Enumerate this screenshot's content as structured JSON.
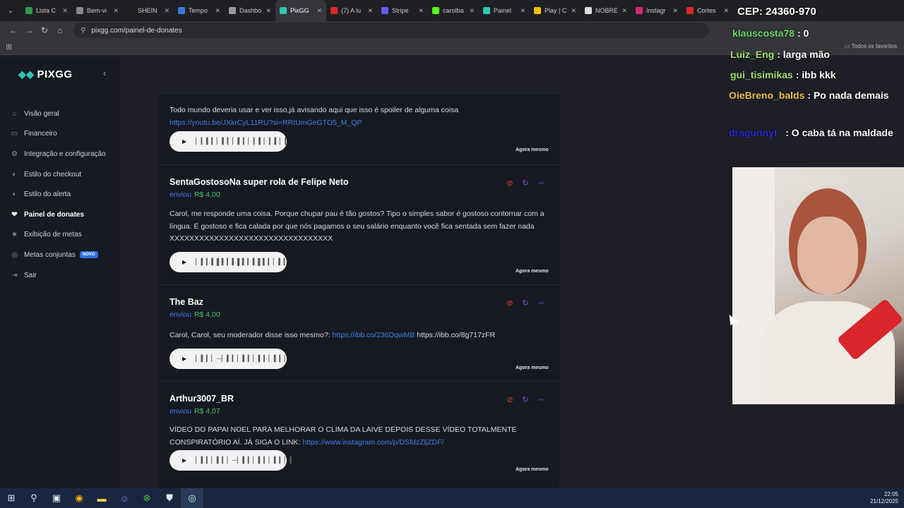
{
  "browser": {
    "tabs": [
      {
        "label": "Lista C",
        "color": "#2e9d4a"
      },
      {
        "label": "Bem-vi",
        "color": "#888888"
      },
      {
        "label": "SHEIN",
        "color": "#222222"
      },
      {
        "label": "Tempo",
        "color": "#3b7be0"
      },
      {
        "label": "Dashbo",
        "color": "#999999"
      },
      {
        "label": "PixGG",
        "color": "#2ec6b4"
      },
      {
        "label": "(7) A lu",
        "color": "#e02828"
      },
      {
        "label": "Stripe",
        "color": "#635bff"
      },
      {
        "label": "carolba",
        "color": "#53fc18"
      },
      {
        "label": "Painel",
        "color": "#2ec6b4"
      },
      {
        "label": "Play | C",
        "color": "#f2c200"
      },
      {
        "label": "NOBRE",
        "color": "#dddddd"
      },
      {
        "label": "Instagr",
        "color": "#d62976"
      },
      {
        "label": "Cortes",
        "color": "#e02828"
      }
    ],
    "active_tab": 5,
    "url": "pixgg.com/painel-de-donates",
    "bookmarks_label": "Todos os favoritos"
  },
  "sidebar": {
    "brand": "PIXGG",
    "items": [
      {
        "label": "Visão geral",
        "icon": "home-icon",
        "glyph": "⌂"
      },
      {
        "label": "Financeiro",
        "icon": "wallet-icon",
        "glyph": "▭"
      },
      {
        "label": "Integração e configuração",
        "icon": "settings-icon",
        "glyph": "⚙"
      },
      {
        "label": "Estilo do checkout",
        "icon": "palette-icon",
        "glyph": "◐"
      },
      {
        "label": "Estilo do alerta",
        "icon": "palette-icon",
        "glyph": "◐"
      },
      {
        "label": "Painel de donates",
        "icon": "donate-icon",
        "glyph": "❤"
      },
      {
        "label": "Exibição de metas",
        "icon": "star-icon",
        "glyph": "★"
      },
      {
        "label": "Metas conjuntas",
        "icon": "target-icon",
        "glyph": "◎",
        "badge": "NOVO"
      },
      {
        "label": "Sair",
        "icon": "logout-icon",
        "glyph": "⇥"
      }
    ],
    "active_index": 5
  },
  "donates": [
    {
      "name": "",
      "sent_label": "",
      "amount": "",
      "message": "Todo mundo deveria usar e ver isso,já avisando aqui que isso é spoiler de alguma coisa",
      "link": "https://youtu.be/JXkrCyL11RU?si=RRtUmGeGTO5_M_QP",
      "link_after": "",
      "waveform": "▏▎▍▎▏▍▎▏▍▎▏▎▍▏▎▍▏▎",
      "time": "Agora mesmo"
    },
    {
      "name": "SentaGostosoNa super rola de Felipe Neto",
      "sent_label": "enviou",
      "amount": "R$ 4,00",
      "message": "Carol, me responde uma coisa. Porque chupar pau é tão gostos? Tipo o simples sabor é gostoso contornar com a língua. É gostoso e fica calada por que nós pagamos o seu salário enquanto você fica sentada sem fazer nada XXXXXXXXXXXXXXXXXXXXXXXXXXXXXXXXX",
      "link": "",
      "link_after": "",
      "waveform": "▏▍▎▍▌▍▎▍▌▍▎▍▌▍▎▏▍▎",
      "time": "Agora mesmo"
    },
    {
      "name": "The Baz",
      "sent_label": "enviou",
      "amount": "R$ 4,00",
      "message": "Carol, Carol, seu moderador disse isso mesmo?:",
      "link": "https://ibb.co/236DqwMB",
      "link_after": "https://ibb.co/8g717zFR",
      "waveform": "▏▍▎▏─▏▍▎▏▍▎▏▍▎▏▍▎▏",
      "time": "Agora mesmo"
    },
    {
      "name": "Arthur3007_BR",
      "sent_label": "enviou",
      "amount": "R$ 4,07",
      "message": "VÍDEO DO PAPAI NOEL PARA MELHORAR O CLIMA DA LAIVE DEPOIS DESSE VÍDEO TOTALMENTE CONSPIRATÓRIO AÍ. JÁ SIGA O LINK:",
      "link": "https://www.instagram.com/p/DSfdzZljZDF/",
      "link_after": "",
      "waveform": "▏▍▎▏▍▎▏─▏▍▎▏▍▎▏▍▎▏▍",
      "time": "Agora mesmo"
    }
  ],
  "stream_overlay": {
    "cep": "CEP: 24360-970",
    "chat": [
      {
        "user": "klauscosta78",
        "color": "#6bd66b",
        "text": ": 0"
      },
      {
        "user": "Luiz_Eng",
        "color": "#9ee06a",
        "text": ": larga mão"
      },
      {
        "user": "gui_tisimikas",
        "color": "#9ee06a",
        "text": ": ibb kkk"
      },
      {
        "user": "OieBreno_balds",
        "color": "#e8c050",
        "text": ": Po nada demais"
      },
      {
        "user": "dragunnyt_",
        "color": "#2b2bd0",
        "text": ": O caba tá na maldade"
      }
    ]
  },
  "taskbar": {
    "time": "22:05",
    "date": "21/12/2025"
  }
}
